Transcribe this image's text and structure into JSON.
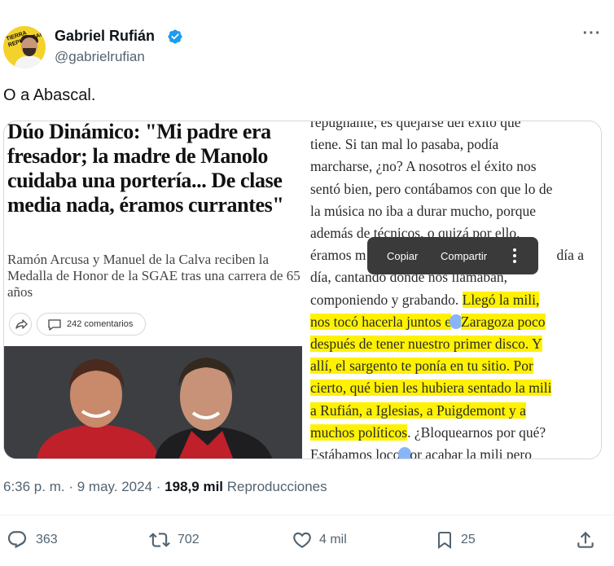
{
  "author": {
    "name": "Gabriel Rufián",
    "handle": "@gabrielrufian",
    "avatar_text": "TIERRA REPUBLICANA"
  },
  "tweet": {
    "text": "O a Abascal."
  },
  "article": {
    "headline": "Dúo Dinámico: \"Mi padre era fresador; la madre de Manolo cuidaba una portería... De clase media nada, éramos currantes\"",
    "subhead": "Ramón Arcusa y Manuel de la Calva reciben la Medalla de Honor de la SGAE tras una carrera de 65 años",
    "comments_label": "242 comentarios"
  },
  "book_page": {
    "lines": [
      {
        "plain": "repugnante, es quejarse del éxito que",
        "highlight": ""
      },
      {
        "plain": "tiene. Si tan mal lo pasaba, podía",
        "highlight": ""
      },
      {
        "plain": "marcharse, ¿no? A nosotros el éxito nos",
        "highlight": ""
      },
      {
        "plain": "sentó bien, pero contábamos con que lo de",
        "highlight": ""
      },
      {
        "plain": "la música no iba a durar mucho, porque",
        "highlight": ""
      },
      {
        "plain": "además de técnicos, o quizá por ello,",
        "highlight": ""
      },
      {
        "plain": "éramos m",
        "highlight": "",
        "tail": "día a"
      },
      {
        "plain": "día, cantando donde nos llamaban,",
        "highlight": ""
      },
      {
        "plain": "componiendo y grabando. ",
        "highlight": "Llegó la mili,"
      },
      {
        "plain": "",
        "highlight": "nos tocó hacerla juntos e",
        "marker": true,
        "highlight_after": "Zaragoza poco"
      },
      {
        "plain": "",
        "highlight": "después de tener nuestro primer disco. Y"
      },
      {
        "plain": "",
        "highlight": "allí, el sargento te ponía en tu sitio. Por"
      },
      {
        "plain": "",
        "highlight": "cierto, qué bien les hubiera sentado la mili"
      },
      {
        "plain": "",
        "highlight": "a Rufián, a Iglesias, a Puigdemont y a"
      },
      {
        "plain": "",
        "highlight": "muchos políticos",
        "after": ". ¿Bloquearnos por qué?"
      },
      {
        "plain": "Estábamos loco",
        "highlight": "",
        "marker": true,
        "after": "or acabar la mili pero"
      }
    ]
  },
  "context_menu": {
    "copy": "Copiar",
    "share": "Compartir"
  },
  "meta": {
    "time": "6:36 p. m.",
    "separator": "·",
    "date": "9 may. 2024",
    "views": "198,9 mil",
    "views_label": "Reproducciones"
  },
  "actions": {
    "replies": "363",
    "reposts": "702",
    "likes": "4 mil",
    "bookmarks": "25"
  },
  "colors": {
    "verified": "#1d9bf0",
    "highlight": "#fff200",
    "muted": "#536471",
    "selection": "#8ab4f8"
  },
  "icons": [
    "verified-badge-icon",
    "more-icon",
    "share-icon",
    "comment-icon",
    "reply-icon",
    "repost-icon",
    "like-icon",
    "bookmark-icon",
    "upload-icon"
  ]
}
